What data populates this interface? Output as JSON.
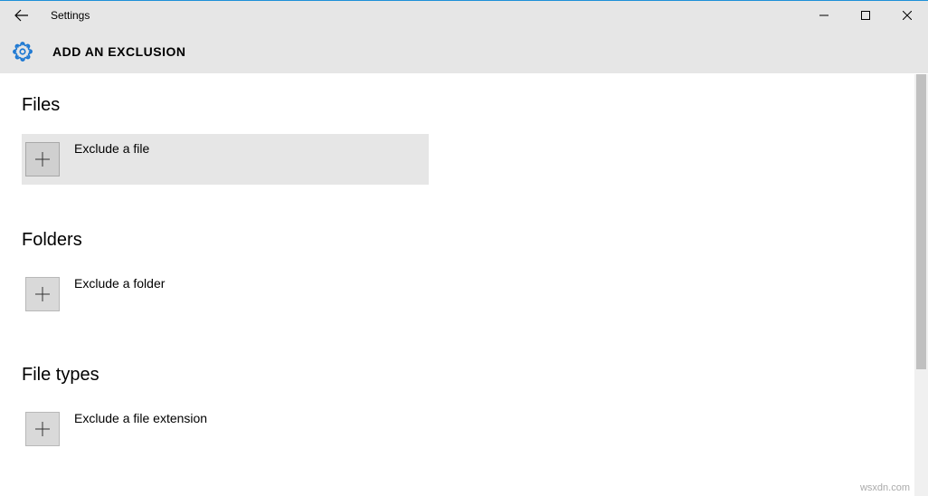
{
  "titlebar": {
    "app_title": "Settings"
  },
  "header": {
    "page_title": "ADD AN EXCLUSION"
  },
  "sections": {
    "files": {
      "heading": "Files",
      "button_label": "Exclude a file"
    },
    "folders": {
      "heading": "Folders",
      "button_label": "Exclude a folder"
    },
    "filetypes": {
      "heading": "File types",
      "button_label": "Exclude a file extension"
    }
  },
  "watermark": "wsxdn.com"
}
